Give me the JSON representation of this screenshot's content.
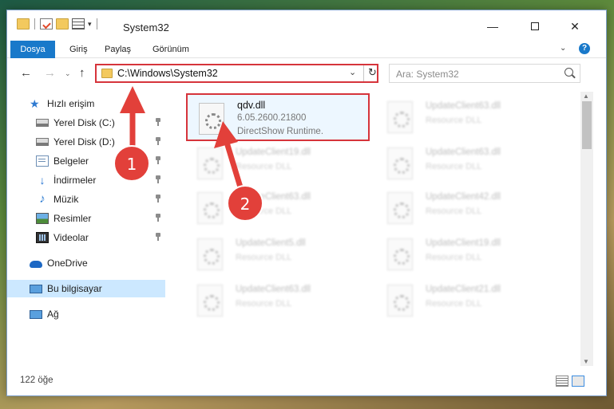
{
  "window": {
    "title": "System32",
    "minimize_icon": "minimize-icon",
    "maximize_icon": "maximize-icon",
    "close_icon": "close-icon",
    "close_glyph": "✕",
    "minimize_glyph": "—"
  },
  "ribbon": {
    "tabs": [
      "Dosya",
      "Giriş",
      "Paylaş",
      "Görünüm"
    ],
    "expand_glyph": "⌄",
    "help_glyph": "?"
  },
  "nav": {
    "back_glyph": "←",
    "forward_glyph": "→",
    "recent_glyph": "⌄",
    "up_glyph": "↑",
    "address": "C:\\Windows\\System32",
    "address_drop": "⌄",
    "refresh_glyph": "↻",
    "search_placeholder": "Ara: System32"
  },
  "sidebar": {
    "items": [
      {
        "label": "Hızlı erişim",
        "icon": "star-icon",
        "pinned": false
      },
      {
        "label": "Yerel Disk (C:)",
        "icon": "disk-icon",
        "pinned": true
      },
      {
        "label": "Yerel Disk (D:)",
        "icon": "disk-icon",
        "pinned": true
      },
      {
        "label": "Belgeler",
        "icon": "documents-icon",
        "pinned": true
      },
      {
        "label": "İndirmeler",
        "icon": "download-icon",
        "pinned": true
      },
      {
        "label": "Müzik",
        "icon": "music-icon",
        "pinned": true
      },
      {
        "label": "Resimler",
        "icon": "pictures-icon",
        "pinned": true
      },
      {
        "label": "Videolar",
        "icon": "videos-icon",
        "pinned": true
      },
      {
        "label": "OneDrive",
        "icon": "onedrive-icon",
        "pinned": false
      },
      {
        "label": "Bu bilgisayar",
        "icon": "computer-icon",
        "pinned": false,
        "selected": true
      },
      {
        "label": "Ağ",
        "icon": "network-icon",
        "pinned": false
      }
    ]
  },
  "files": {
    "highlighted": {
      "name": "qdv.dll",
      "version": "6.05.2600.21800",
      "description": "DirectShow Runtime."
    },
    "right_column": [
      {
        "name": "UpdateClient63.dll",
        "description": "Resource DLL"
      },
      {
        "name": "UpdateClient63.dll",
        "description": "Resource DLL"
      },
      {
        "name": "UpdateClient42.dll",
        "description": "Resource DLL"
      },
      {
        "name": "UpdateClient19.dll",
        "description": "Resource DLL"
      },
      {
        "name": "UpdateClient21.dll",
        "description": "Resource DLL"
      }
    ],
    "left_column": [
      {
        "name": "UpdateClient19.dll",
        "description": "Resource DLL"
      },
      {
        "name": "UpdateClient63.dll",
        "description": "Resource DLL"
      },
      {
        "name": "UpdateClient5.dll",
        "description": "Resource DLL"
      },
      {
        "name": "UpdateClient63.dll",
        "description": "Resource DLL"
      }
    ]
  },
  "status": {
    "item_count": "122 öğe"
  },
  "annotations": {
    "step1": "1",
    "step2": "2",
    "arrow_color": "#e2403a"
  }
}
